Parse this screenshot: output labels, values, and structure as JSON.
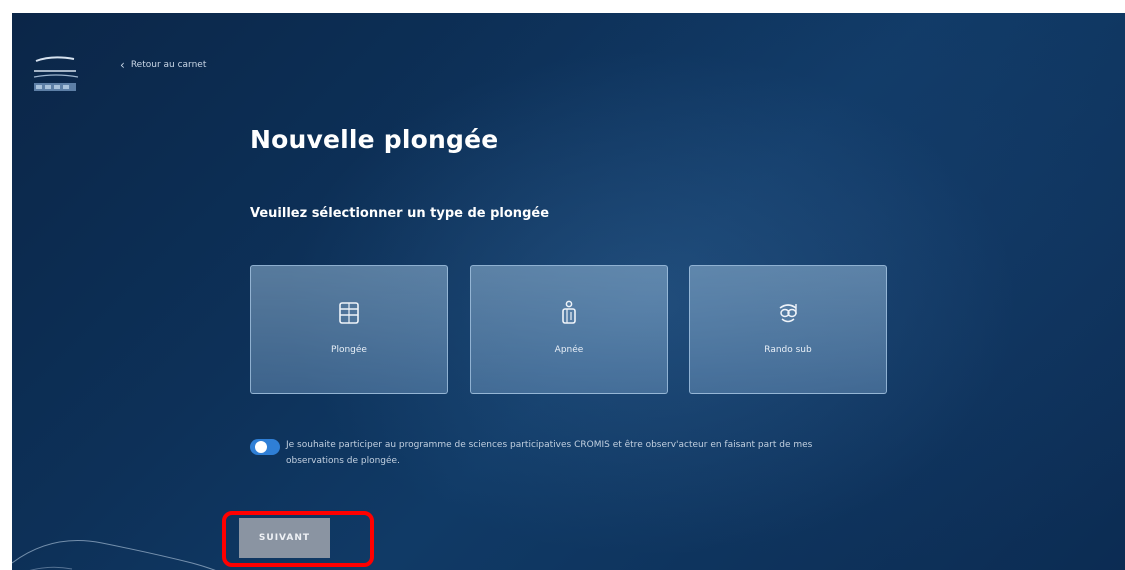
{
  "header": {
    "back_label": "Retour au carnet"
  },
  "main": {
    "title": "Nouvelle plongée",
    "subtitle": "Veuillez sélectionner un type de plongée",
    "dive_types": [
      {
        "label": "Plongée",
        "icon": "scuba-tank-icon"
      },
      {
        "label": "Apnée",
        "icon": "freediver-icon"
      },
      {
        "label": "Rando sub",
        "icon": "snorkel-mask-icon"
      }
    ],
    "consent": {
      "enabled": true,
      "text": "Je souhaite participer au programme de sciences participatives CROMIS et être observ'acteur en faisant part de mes observations de plongée."
    },
    "next_label": "SUIVANT"
  },
  "colors": {
    "background": "#0d3159",
    "card_fill": "#8fb3d3",
    "toggle": "#2f7fd6",
    "button": "#8a94a2",
    "highlight": "#ff0000"
  }
}
